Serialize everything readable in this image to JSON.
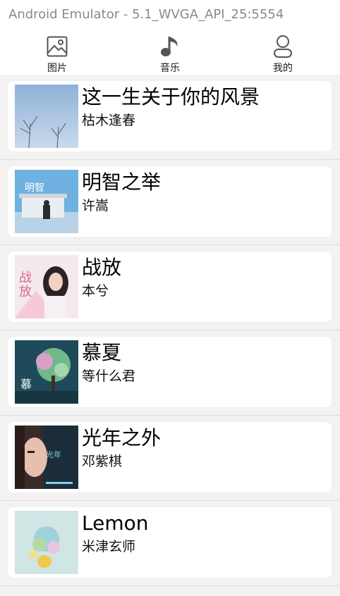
{
  "window": {
    "title": "Android Emulator - 5.1_WVGA_API_25:5554"
  },
  "tabs": [
    {
      "label": "图片",
      "icon": "image-icon"
    },
    {
      "label": "音乐",
      "icon": "music-note-icon"
    },
    {
      "label": "我的",
      "icon": "person-icon"
    }
  ],
  "songs": [
    {
      "title": "这一生关于你的风景",
      "artist": "枯木逢春",
      "cover": "album-cover-blue-sky"
    },
    {
      "title": "明智之举",
      "artist": "许嵩",
      "cover": "album-cover-lifeguard-tower"
    },
    {
      "title": "战放",
      "artist": "本兮",
      "cover": "album-cover-girl-portrait"
    },
    {
      "title": "慕夏",
      "artist": "等什么君",
      "cover": "album-cover-flower-tree"
    },
    {
      "title": "光年之外",
      "artist": "邓紫棋",
      "cover": "album-cover-face-closeup"
    },
    {
      "title": "Lemon",
      "artist": "米津玄师",
      "cover": "album-cover-lemon-art"
    }
  ]
}
